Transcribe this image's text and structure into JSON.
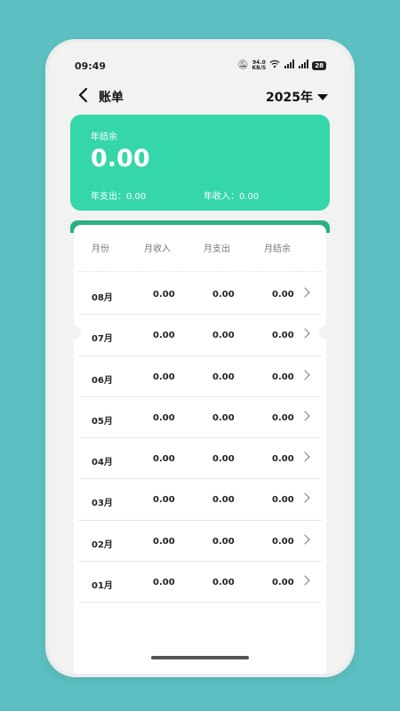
{
  "status_bar": {
    "time": "09:49",
    "net_speed_value": "94.0",
    "net_speed_unit": "KB/S",
    "signal_1": "⁵ᴳıl",
    "signal_2": "⁵ᴳıl",
    "battery": "28"
  },
  "nav": {
    "back_icon": "chevron-left-icon",
    "title": "账单",
    "year": "2025年",
    "year_icon": "caret-down-icon"
  },
  "summary": {
    "label": "年结余",
    "amount": "0.00",
    "expense_label": "年支出：",
    "expense_value": "0.00",
    "income_label": "年收入：",
    "income_value": "0.00"
  },
  "table": {
    "headers": [
      "月份",
      "月收入",
      "月支出",
      "月结余"
    ],
    "rows": [
      {
        "month": "08月",
        "income": "0.00",
        "expense": "0.00",
        "balance": "0.00"
      },
      {
        "month": "07月",
        "income": "0.00",
        "expense": "0.00",
        "balance": "0.00"
      },
      {
        "month": "06月",
        "income": "0.00",
        "expense": "0.00",
        "balance": "0.00"
      },
      {
        "month": "05月",
        "income": "0.00",
        "expense": "0.00",
        "balance": "0.00"
      },
      {
        "month": "04月",
        "income": "0.00",
        "expense": "0.00",
        "balance": "0.00"
      },
      {
        "month": "03月",
        "income": "0.00",
        "expense": "0.00",
        "balance": "0.00"
      },
      {
        "month": "02月",
        "income": "0.00",
        "expense": "0.00",
        "balance": "0.00"
      },
      {
        "month": "01月",
        "income": "0.00",
        "expense": "0.00",
        "balance": "0.00"
      }
    ]
  },
  "colors": {
    "background": "#5cbfc1",
    "summary_card": "#35d6aa",
    "table_strip": "#2bb07f"
  }
}
